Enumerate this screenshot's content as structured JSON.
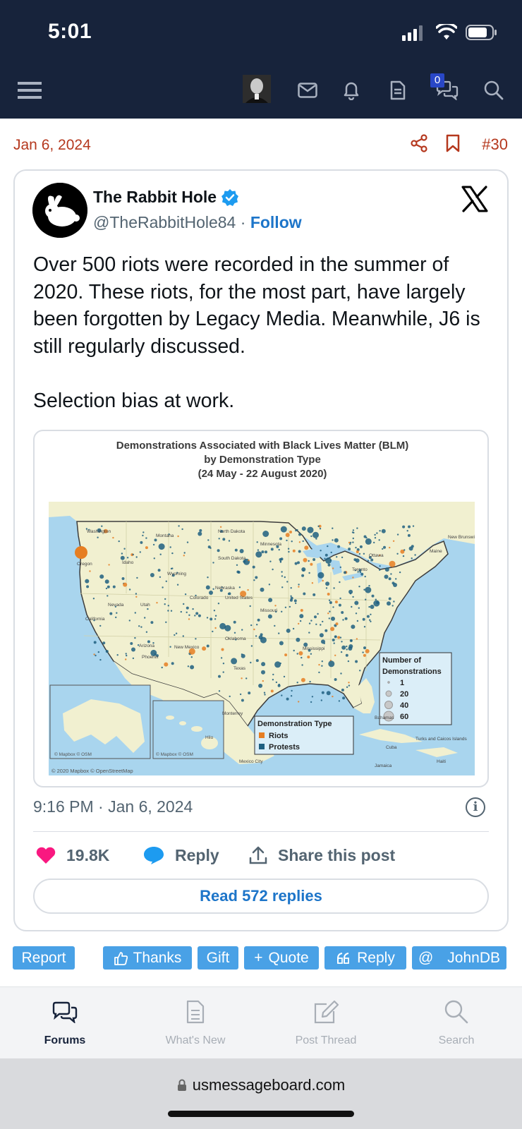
{
  "status_bar": {
    "time": "5:01"
  },
  "nav": {
    "inbox_count": "0"
  },
  "post": {
    "date": "Jan 6, 2024",
    "number": "#30"
  },
  "tweet": {
    "author": "The Rabbit Hole",
    "handle": "@TheRabbitHole84",
    "separator": " · ",
    "follow": "Follow",
    "text": "Over 500 riots were recorded in the summer of 2020. These riots, for the most part, have largely been forgotten by Legacy Media. Meanwhile, J6 is still regularly discussed.\n\nSelection bias at work.",
    "timestamp": "9:16 PM · Jan 6, 2024",
    "likes": "19.8K",
    "reply_label": "Reply",
    "share_label": "Share this post",
    "read_replies": "Read 572 replies"
  },
  "map": {
    "title_line1": "Demonstrations Associated with Black Lives Matter (BLM)",
    "title_line2": "by Demonstration Type",
    "title_line3": "(24 May - 22 August 2020)",
    "legend_size_title_1": "Number of",
    "legend_size_title_2": "Demonstrations",
    "legend_sizes": [
      "1",
      "20",
      "40",
      "60"
    ],
    "legend_type_title": "Demonstration Type",
    "legend_types": [
      "Riots",
      "Protests"
    ],
    "attribution": "© 2020 Mapbox © OpenStreetMap",
    "inset_attribution": "© Mapbox © OSM",
    "colors": {
      "riots": "#e67e22",
      "protests": "#1f5f80",
      "land": "#f1f0d0",
      "water": "#a9d5ee"
    },
    "labels": [
      "Washington",
      "Montana",
      "North Dakota",
      "Minnesota",
      "Oregon",
      "Idaho",
      "South Dakota",
      "Wyoming",
      "Nebraska",
      "United States",
      "Nevada",
      "Utah",
      "Colorado",
      "California",
      "Arizona",
      "New Mexico",
      "Oklahoma",
      "Texas",
      "Missouri",
      "Mississippi",
      "Ottawa",
      "Toronto",
      "Maine",
      "New Brunswick",
      "Mexico City",
      "Monterrey",
      "Phoenix",
      "Cuba",
      "Jamaica",
      "Haiti",
      "Bahamas",
      "Turks and Caicos Islands",
      "Hilo"
    ]
  },
  "forum_buttons": {
    "report": "Report",
    "thanks": "Thanks",
    "gift": "Gift",
    "quote": "Quote",
    "reply": "Reply",
    "mention": "JohnDB"
  },
  "tabs": [
    {
      "label": "Forums"
    },
    {
      "label": "What's New"
    },
    {
      "label": "Post Thread"
    },
    {
      "label": "Search"
    }
  ],
  "browser": {
    "url": "usmessageboard.com"
  }
}
